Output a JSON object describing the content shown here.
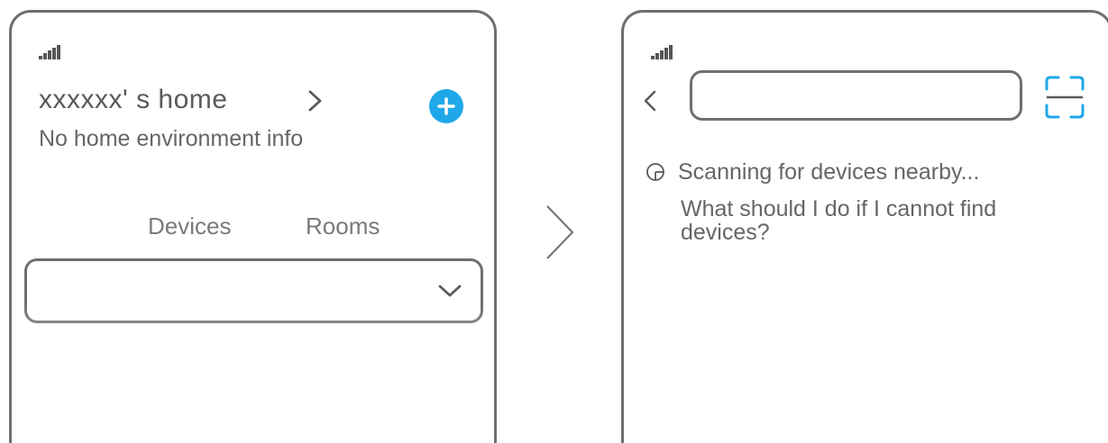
{
  "left_screen": {
    "home_title": "xxxxxx' s  home",
    "home_subtitle": "No home environment info",
    "tabs": [
      {
        "label": "Devices"
      },
      {
        "label": "Rooms"
      }
    ],
    "icons": {
      "signal": "signal-icon",
      "home_chevron": "chevron-right-icon",
      "add": "plus-circle-icon",
      "dropdown": "chevron-down-icon"
    }
  },
  "flow_arrow": "chevron-right-icon",
  "right_screen": {
    "search": {
      "value": "",
      "placeholder": ""
    },
    "scan_status": "Scanning for devices nearby...",
    "help_link": "What should I do if I cannot find devices?",
    "icons": {
      "signal": "signal-icon",
      "back": "chevron-left-icon",
      "scan": "scan-frame-icon",
      "spinner": "loading-icon"
    }
  },
  "colors": {
    "accent": "#1ea8e9",
    "frame": "#6f6f6f",
    "text": "#5a5a5a"
  }
}
